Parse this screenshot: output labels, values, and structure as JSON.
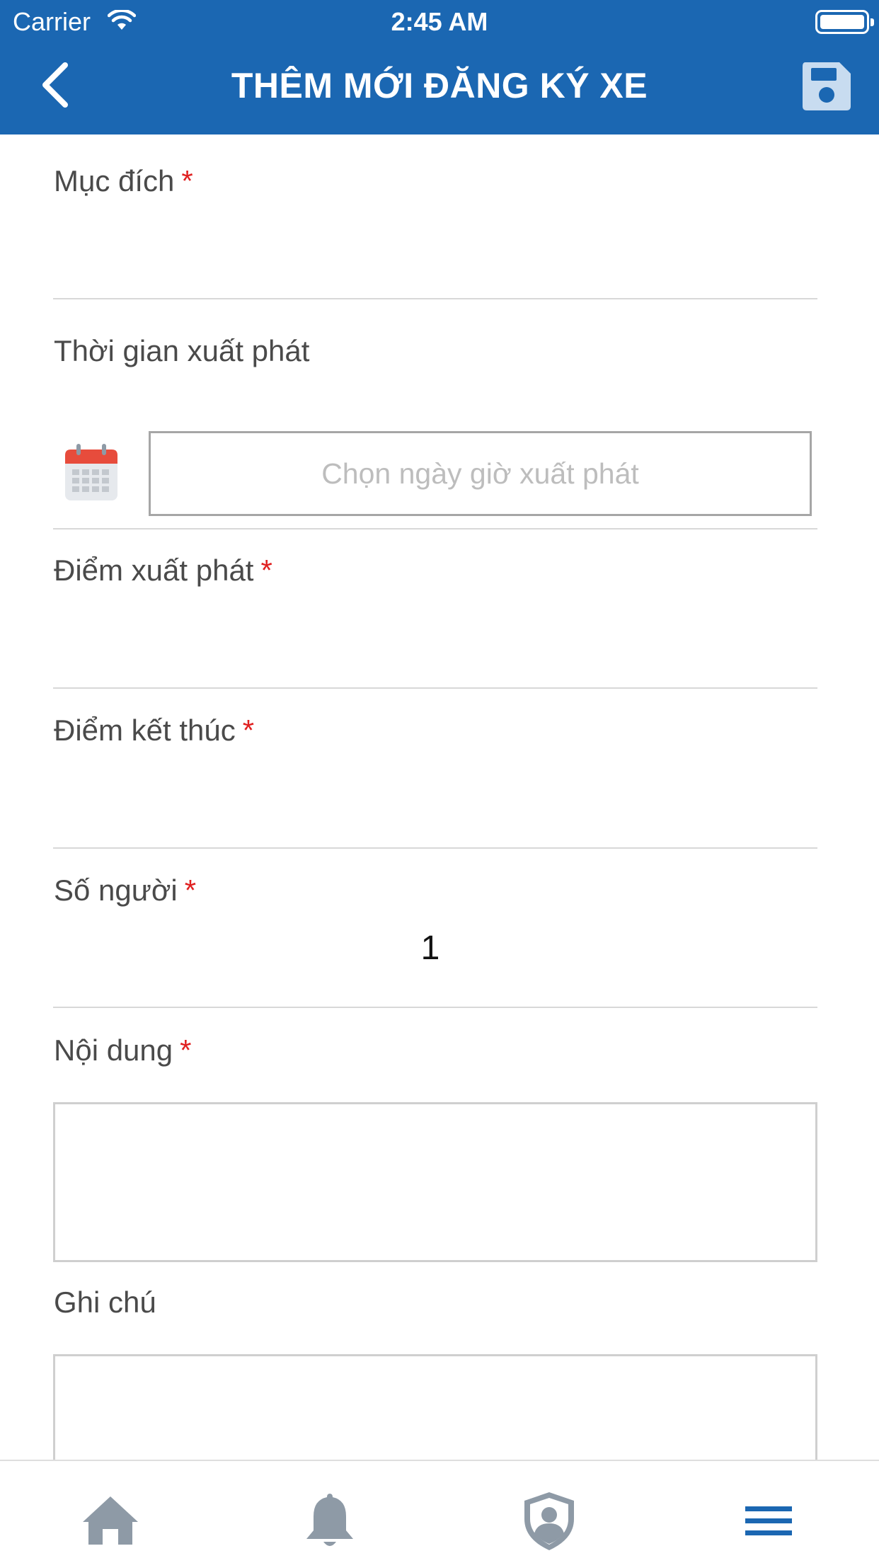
{
  "status_bar": {
    "carrier": "Carrier",
    "time": "2:45 AM"
  },
  "header": {
    "title": "THÊM MỚI ĐĂNG KÝ XE",
    "back_icon": "chevron-left-icon",
    "save_icon": "floppy-disk-icon"
  },
  "form": {
    "purpose": {
      "label": "Mục đích",
      "required_mark": "*",
      "value": ""
    },
    "departure_time": {
      "label": "Thời gian xuất phát",
      "calendar_icon": "calendar-icon",
      "placeholder": "Chọn ngày giờ xuất phát"
    },
    "start_point": {
      "label": "Điểm xuất phát",
      "required_mark": "*",
      "value": ""
    },
    "end_point": {
      "label": "Điểm kết thúc",
      "required_mark": "*",
      "value": ""
    },
    "passengers": {
      "label": "Số người",
      "required_mark": "*",
      "value": "1"
    },
    "content": {
      "label": "Nội dung",
      "required_mark": "*",
      "value": ""
    },
    "note": {
      "label": "Ghi chú",
      "value": ""
    }
  },
  "tabbar": {
    "items": [
      {
        "icon": "home-icon",
        "active": false
      },
      {
        "icon": "bell-icon",
        "active": false
      },
      {
        "icon": "shield-user-icon",
        "active": false
      },
      {
        "icon": "menu-icon",
        "active": true
      }
    ]
  },
  "colors": {
    "header_bg": "#1b67b2",
    "required": "#e02020",
    "tab_inactive": "#8e9aa6",
    "tab_active": "#1b67b2",
    "calendar_red": "#e74c3c"
  }
}
